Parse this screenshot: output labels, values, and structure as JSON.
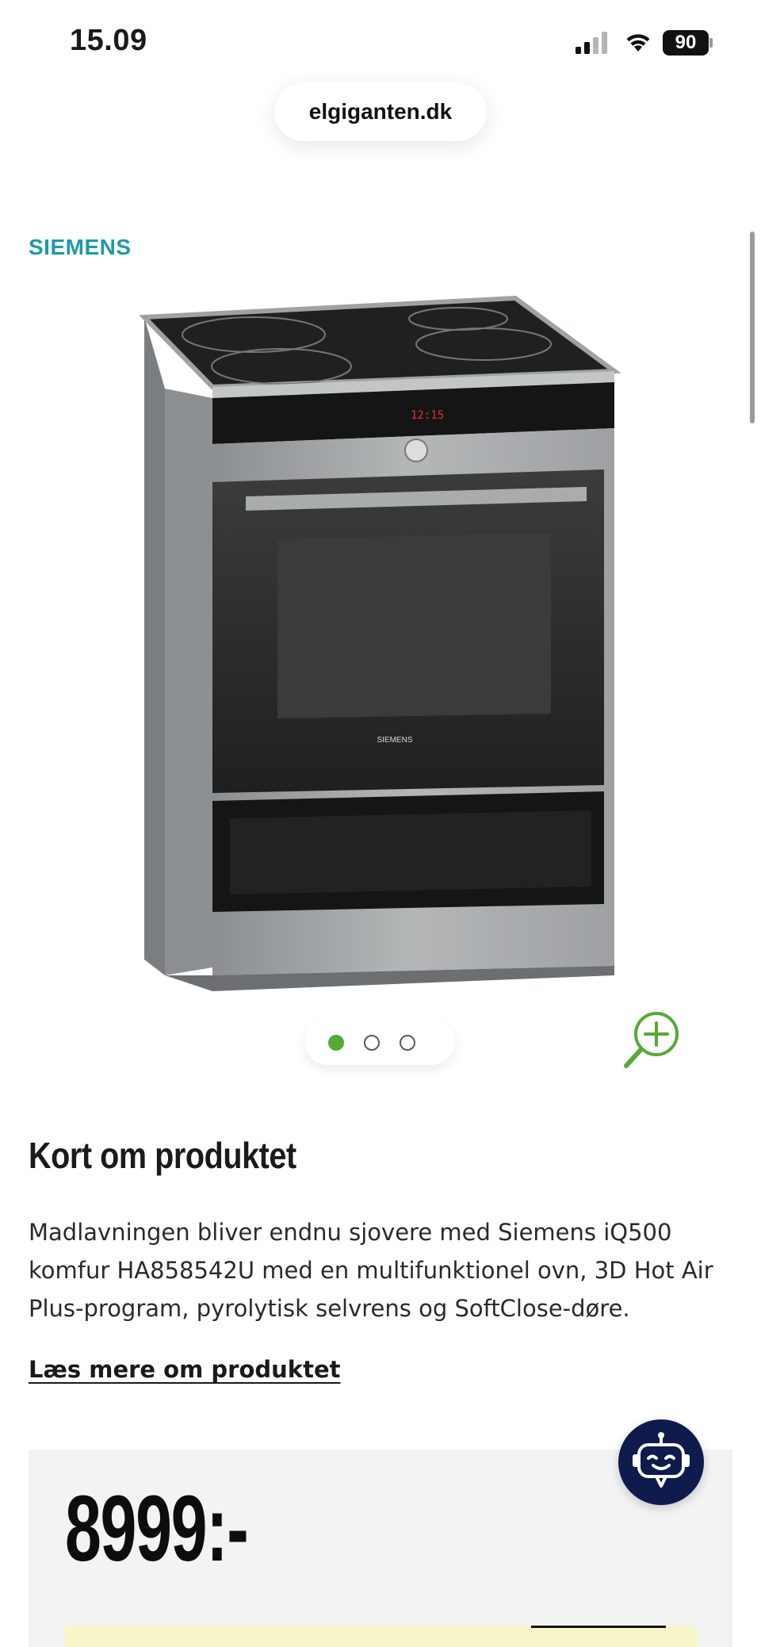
{
  "status_bar": {
    "time": "15.09",
    "battery_level": "90",
    "icons": [
      "signal-icon",
      "wifi-icon",
      "battery-icon"
    ]
  },
  "browser": {
    "url": "elgiganten.dk"
  },
  "product": {
    "brand": "SIEMENS",
    "image_icon": "electric-range-oven-image",
    "gallery": {
      "count": 3,
      "active_index": 0
    }
  },
  "summary": {
    "title": "Kort om produktet",
    "description": "Madlavningen bliver endnu sjovere med Siemens iQ500 komfur HA858542U med en multifunktionel ovn, 3D Hot Air Plus-program, pyrolytisk selvrens og SoftClose-døre.",
    "read_more_label": "Læs mere om produktet"
  },
  "pricing": {
    "price": "8999:-"
  },
  "colors": {
    "brand_teal": "#1e9aa6",
    "accent_green": "#57a934",
    "chatbot_navy": "#0f1b4d",
    "price_box_bg": "#f3f3f3",
    "notice_yellow": "#f7f6c9"
  }
}
